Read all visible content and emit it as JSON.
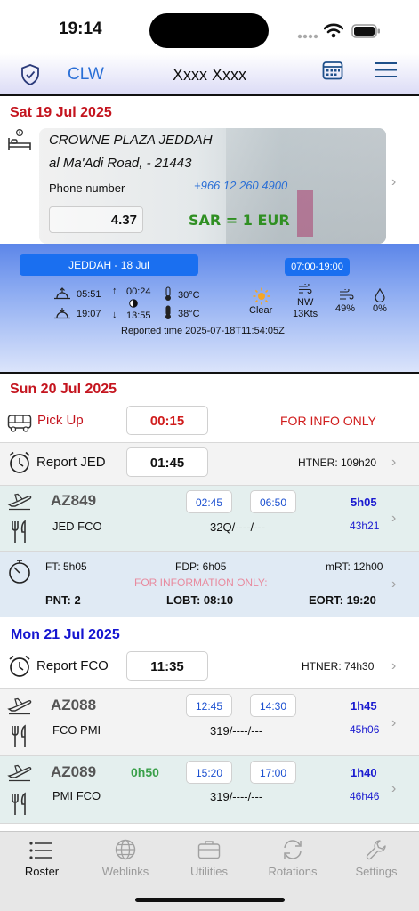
{
  "status_bar": {
    "time": "19:14"
  },
  "nav": {
    "left_label": "CLW",
    "title": "Xxxx Xxxx"
  },
  "day1": {
    "header": "Sat 19 Jul 2025",
    "hotel": {
      "name": "CROWNE PLAZA JEDDAH",
      "address": "al Ma'Adi Road,  - 21443",
      "phone_label": "Phone number",
      "phone": "+966 12 260 4900",
      "rate": "4.37",
      "currency": "SAR = 1 EUR"
    },
    "weather": {
      "place": "JEDDAH - 18 Jul",
      "hours": "07:00-19:00",
      "sunrise": "05:51",
      "sunset": "19:07",
      "moonrise": "00:24",
      "moonset": "13:55",
      "temp_min": "30°C",
      "temp_max": "38°C",
      "condition": "Clear",
      "wind_dir": "NW",
      "wind_speed": "13Kts",
      "humidity": "49%",
      "precip": "0%",
      "reported": "Reported time  2025-07-18T11:54:05Z"
    }
  },
  "day2": {
    "header": "Sun 20 Jul 2025",
    "pickup": {
      "label": "Pick Up",
      "time": "00:15",
      "note": "FOR INFO ONLY"
    },
    "report": {
      "label": "Report JED",
      "time": "01:45",
      "htner": "HTNER: 109h20"
    },
    "flight": {
      "number": "AZ849",
      "dep": "02:45",
      "arr": "06:50",
      "duration": "5h05",
      "route": "JED FCO",
      "crew": "32Q/----/---",
      "cumulative": "43h21"
    },
    "duty": {
      "ft": "FT: 5h05",
      "fdp": "FDP: 6h05",
      "mrt": "mRT: 12h00",
      "note": "FOR INFORMATION ONLY:",
      "pnt": "PNT: 2",
      "lobt": "LOBT: 08:10",
      "eort": "EORT: 19:20"
    }
  },
  "day3": {
    "header": "Mon 21 Jul 2025",
    "report": {
      "label": "Report FCO",
      "time": "11:35",
      "htner": "HTNER: 74h30"
    },
    "flight1": {
      "number": "AZ088",
      "dep": "12:45",
      "arr": "14:30",
      "duration": "1h45",
      "route": "FCO PMI",
      "crew": "319/----/---",
      "cumulative": "45h06"
    },
    "flight2": {
      "number": "AZ089",
      "ground": "0h50",
      "dep": "15:20",
      "arr": "17:00",
      "duration": "1h40",
      "route": "PMI FCO",
      "crew": "319/----/---",
      "cumulative": "46h46"
    }
  },
  "tabs": [
    {
      "label": "Roster",
      "icon": "list-icon",
      "active": true
    },
    {
      "label": "Weblinks",
      "icon": "globe-icon",
      "active": false
    },
    {
      "label": "Utilities",
      "icon": "briefcase-icon",
      "active": false
    },
    {
      "label": "Rotations",
      "icon": "rotate-icon",
      "active": false
    },
    {
      "label": "Settings",
      "icon": "wrench-icon",
      "active": false
    }
  ],
  "colors": {
    "accent_blue": "#2a6fd6",
    "day_red": "#c4141e",
    "day_blue": "#1515d0",
    "currency_green": "#2f8f22",
    "weather_pill": "#1a6ff0"
  }
}
